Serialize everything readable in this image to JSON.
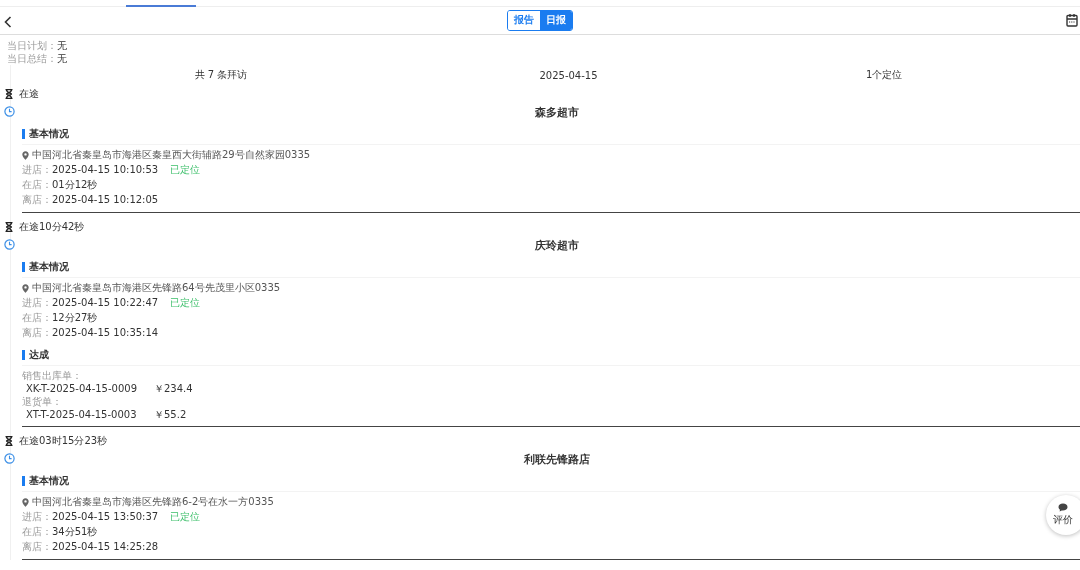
{
  "header": {
    "tabs": [
      {
        "label": "报告",
        "selected": false
      },
      {
        "label": "日报",
        "selected": true
      }
    ]
  },
  "daily": [
    {
      "label": "当日计划：",
      "value": "无"
    },
    {
      "label": "当日总结：",
      "value": "无"
    }
  ],
  "overview": {
    "visits": "共 7 条拜访",
    "date": "2025-04-15",
    "locations": "1个定位"
  },
  "visits": [
    {
      "travel": "在途",
      "store": "森多超市",
      "section": "基本情况",
      "address": "中国河北省秦皇岛市海港区秦皇西大街辅路29号自然家园0335",
      "entries": [
        {
          "label": "进店：",
          "value": "2025-04-15 10:10:53",
          "tag": "已定位"
        },
        {
          "label": "在店：",
          "value": "01分12秒"
        },
        {
          "label": "离店：",
          "value": "2025-04-15 10:12:05"
        }
      ]
    },
    {
      "travel": "在途10分42秒",
      "store": "庆玲超市",
      "section": "基本情况",
      "address": "中国河北省秦皇岛市海港区先锋路64号先茂里小区0335",
      "entries": [
        {
          "label": "进店：",
          "value": "2025-04-15 10:22:47",
          "tag": "已定位"
        },
        {
          "label": "在店：",
          "value": "12分27秒"
        },
        {
          "label": "离店：",
          "value": "2025-04-15 10:35:14"
        }
      ],
      "achievement": {
        "title": "达成",
        "orders": [
          {
            "type": "销售出库单：",
            "number": "XK-T-2025-04-15-0009",
            "amount": "￥234.4"
          },
          {
            "type": "退货单：",
            "number": "XT-T-2025-04-15-0003",
            "amount": "￥55.2"
          }
        ]
      }
    },
    {
      "travel": "在途03时15分23秒",
      "store": "利联先锋路店",
      "section": "基本情况",
      "address": "中国河北省秦皇岛市海港区先锋路6-2号在水一方0335",
      "entries": [
        {
          "label": "进店：",
          "value": "2025-04-15 13:50:37",
          "tag": "已定位"
        },
        {
          "label": "在店：",
          "value": "34分51秒"
        },
        {
          "label": "离店：",
          "value": "2025-04-15 14:25:28"
        }
      ]
    }
  ],
  "feedback_button": "评价"
}
